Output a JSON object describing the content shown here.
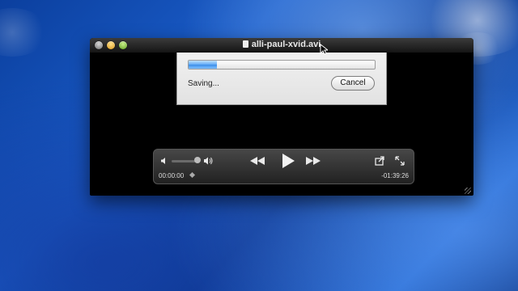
{
  "window": {
    "title": "alli-paul-xvid.avi"
  },
  "save_sheet": {
    "progress": 0.15,
    "status_text": "Saving...",
    "cancel_label": "Cancel"
  },
  "player": {
    "elapsed": "00:00:00",
    "remaining": "-01:39:26",
    "volume": 0.85
  },
  "icons": {
    "close": "window-close-icon",
    "minimize": "window-minimize-icon",
    "maximize": "window-zoom-icon",
    "volume_low": "volume-low-icon",
    "volume_high": "volume-high-icon",
    "rewind": "rewind-icon",
    "play": "play-icon",
    "fast_forward": "fast-forward-icon",
    "share": "share-icon",
    "fullscreen": "fullscreen-icon"
  },
  "colors": {
    "progress_blue": "#3c8ee8",
    "desktop_blue": "#1a5cc8"
  }
}
